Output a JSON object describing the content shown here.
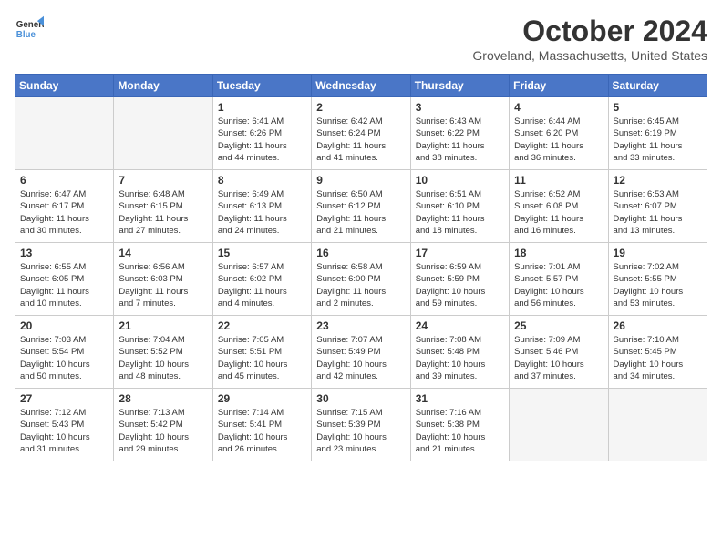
{
  "logo": {
    "line1": "General",
    "line2": "Blue"
  },
  "title": "October 2024",
  "location": "Groveland, Massachusetts, United States",
  "days_header": [
    "Sunday",
    "Monday",
    "Tuesday",
    "Wednesday",
    "Thursday",
    "Friday",
    "Saturday"
  ],
  "weeks": [
    [
      {
        "day": "",
        "info": ""
      },
      {
        "day": "",
        "info": ""
      },
      {
        "day": "1",
        "info": "Sunrise: 6:41 AM\nSunset: 6:26 PM\nDaylight: 11 hours\nand 44 minutes."
      },
      {
        "day": "2",
        "info": "Sunrise: 6:42 AM\nSunset: 6:24 PM\nDaylight: 11 hours\nand 41 minutes."
      },
      {
        "day": "3",
        "info": "Sunrise: 6:43 AM\nSunset: 6:22 PM\nDaylight: 11 hours\nand 38 minutes."
      },
      {
        "day": "4",
        "info": "Sunrise: 6:44 AM\nSunset: 6:20 PM\nDaylight: 11 hours\nand 36 minutes."
      },
      {
        "day": "5",
        "info": "Sunrise: 6:45 AM\nSunset: 6:19 PM\nDaylight: 11 hours\nand 33 minutes."
      }
    ],
    [
      {
        "day": "6",
        "info": "Sunrise: 6:47 AM\nSunset: 6:17 PM\nDaylight: 11 hours\nand 30 minutes."
      },
      {
        "day": "7",
        "info": "Sunrise: 6:48 AM\nSunset: 6:15 PM\nDaylight: 11 hours\nand 27 minutes."
      },
      {
        "day": "8",
        "info": "Sunrise: 6:49 AM\nSunset: 6:13 PM\nDaylight: 11 hours\nand 24 minutes."
      },
      {
        "day": "9",
        "info": "Sunrise: 6:50 AM\nSunset: 6:12 PM\nDaylight: 11 hours\nand 21 minutes."
      },
      {
        "day": "10",
        "info": "Sunrise: 6:51 AM\nSunset: 6:10 PM\nDaylight: 11 hours\nand 18 minutes."
      },
      {
        "day": "11",
        "info": "Sunrise: 6:52 AM\nSunset: 6:08 PM\nDaylight: 11 hours\nand 16 minutes."
      },
      {
        "day": "12",
        "info": "Sunrise: 6:53 AM\nSunset: 6:07 PM\nDaylight: 11 hours\nand 13 minutes."
      }
    ],
    [
      {
        "day": "13",
        "info": "Sunrise: 6:55 AM\nSunset: 6:05 PM\nDaylight: 11 hours\nand 10 minutes."
      },
      {
        "day": "14",
        "info": "Sunrise: 6:56 AM\nSunset: 6:03 PM\nDaylight: 11 hours\nand 7 minutes."
      },
      {
        "day": "15",
        "info": "Sunrise: 6:57 AM\nSunset: 6:02 PM\nDaylight: 11 hours\nand 4 minutes."
      },
      {
        "day": "16",
        "info": "Sunrise: 6:58 AM\nSunset: 6:00 PM\nDaylight: 11 hours\nand 2 minutes."
      },
      {
        "day": "17",
        "info": "Sunrise: 6:59 AM\nSunset: 5:59 PM\nDaylight: 10 hours\nand 59 minutes."
      },
      {
        "day": "18",
        "info": "Sunrise: 7:01 AM\nSunset: 5:57 PM\nDaylight: 10 hours\nand 56 minutes."
      },
      {
        "day": "19",
        "info": "Sunrise: 7:02 AM\nSunset: 5:55 PM\nDaylight: 10 hours\nand 53 minutes."
      }
    ],
    [
      {
        "day": "20",
        "info": "Sunrise: 7:03 AM\nSunset: 5:54 PM\nDaylight: 10 hours\nand 50 minutes."
      },
      {
        "day": "21",
        "info": "Sunrise: 7:04 AM\nSunset: 5:52 PM\nDaylight: 10 hours\nand 48 minutes."
      },
      {
        "day": "22",
        "info": "Sunrise: 7:05 AM\nSunset: 5:51 PM\nDaylight: 10 hours\nand 45 minutes."
      },
      {
        "day": "23",
        "info": "Sunrise: 7:07 AM\nSunset: 5:49 PM\nDaylight: 10 hours\nand 42 minutes."
      },
      {
        "day": "24",
        "info": "Sunrise: 7:08 AM\nSunset: 5:48 PM\nDaylight: 10 hours\nand 39 minutes."
      },
      {
        "day": "25",
        "info": "Sunrise: 7:09 AM\nSunset: 5:46 PM\nDaylight: 10 hours\nand 37 minutes."
      },
      {
        "day": "26",
        "info": "Sunrise: 7:10 AM\nSunset: 5:45 PM\nDaylight: 10 hours\nand 34 minutes."
      }
    ],
    [
      {
        "day": "27",
        "info": "Sunrise: 7:12 AM\nSunset: 5:43 PM\nDaylight: 10 hours\nand 31 minutes."
      },
      {
        "day": "28",
        "info": "Sunrise: 7:13 AM\nSunset: 5:42 PM\nDaylight: 10 hours\nand 29 minutes."
      },
      {
        "day": "29",
        "info": "Sunrise: 7:14 AM\nSunset: 5:41 PM\nDaylight: 10 hours\nand 26 minutes."
      },
      {
        "day": "30",
        "info": "Sunrise: 7:15 AM\nSunset: 5:39 PM\nDaylight: 10 hours\nand 23 minutes."
      },
      {
        "day": "31",
        "info": "Sunrise: 7:16 AM\nSunset: 5:38 PM\nDaylight: 10 hours\nand 21 minutes."
      },
      {
        "day": "",
        "info": ""
      },
      {
        "day": "",
        "info": ""
      }
    ]
  ]
}
